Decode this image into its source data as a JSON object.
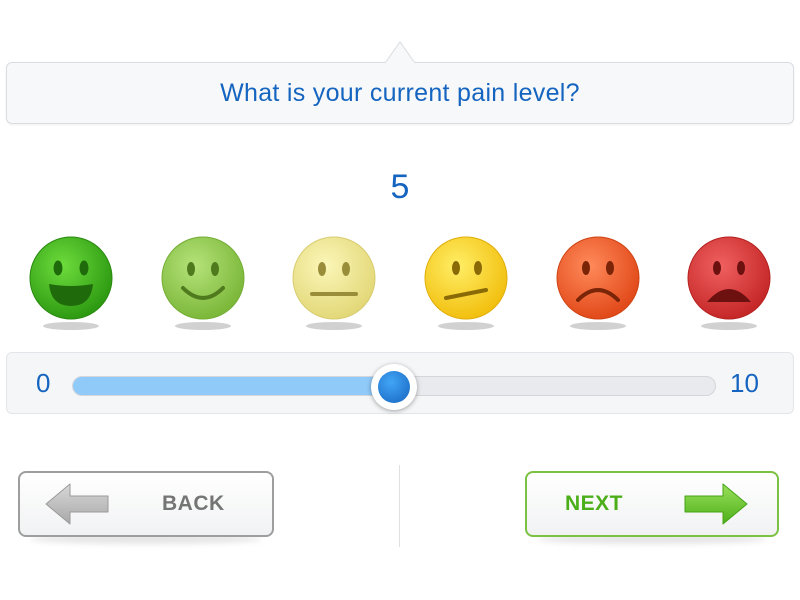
{
  "question": {
    "text": "What is your current pain level?"
  },
  "pain": {
    "value": "5",
    "value_number": 5,
    "min_label": "0",
    "max_label": "10",
    "min": 0,
    "max": 10
  },
  "faces": [
    {
      "name": "very-happy-face-icon",
      "color": "#4caf1a"
    },
    {
      "name": "happy-face-icon",
      "color": "#8bc34a"
    },
    {
      "name": "neutral-face-icon",
      "color": "#f0e68c"
    },
    {
      "name": "uneasy-face-icon",
      "color": "#fdd835"
    },
    {
      "name": "sad-face-icon",
      "color": "#f4511e"
    },
    {
      "name": "very-sad-face-icon",
      "color": "#d32f2f"
    }
  ],
  "buttons": {
    "back_label": "BACK",
    "next_label": "NEXT"
  },
  "colors": {
    "accent": "#1565c0",
    "slider_fill": "#90caf9",
    "next_border": "#7cc242",
    "next_text": "#4caf1a",
    "back_border": "#9e9e9e",
    "back_text": "#757575"
  }
}
